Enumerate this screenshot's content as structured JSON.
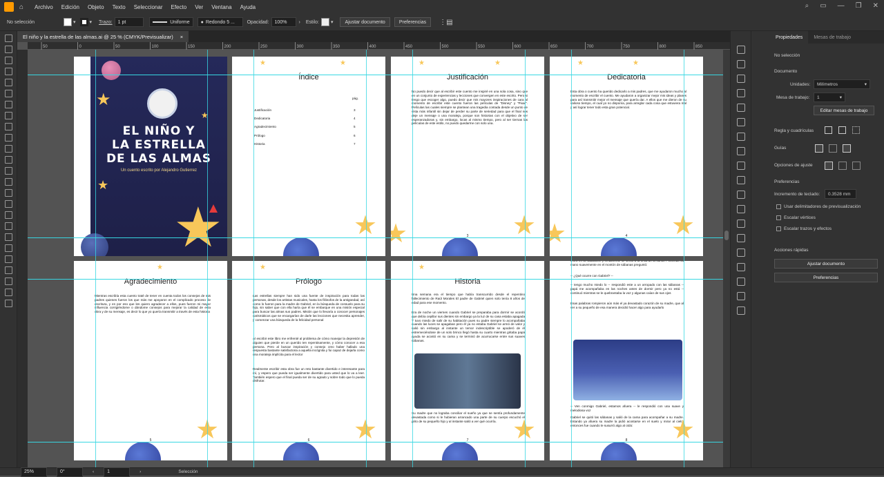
{
  "menubar": {
    "items": [
      "Archivo",
      "Edición",
      "Objeto",
      "Texto",
      "Seleccionar",
      "Efecto",
      "Ver",
      "Ventana",
      "Ayuda"
    ]
  },
  "control": {
    "selection": "No selección",
    "stroke_label": "Trazo:",
    "stroke_value": "1 pt",
    "profile": "Uniforme",
    "brush": "Redondo 5 ...",
    "opacity_label": "Opacidad:",
    "opacity_value": "100%",
    "style_label": "Estilo:",
    "fit_button": "Ajustar documento",
    "prefs_button": "Preferencias"
  },
  "doc_tab": {
    "title": "El niño y la estrella de las almas.ai @ 25 % (CMYK/Previsualizar)",
    "close": "×"
  },
  "ruler": {
    "ticks": [
      "50",
      "0",
      "50",
      "100",
      "150",
      "200",
      "250",
      "300",
      "350",
      "400",
      "450",
      "500",
      "550",
      "600",
      "650",
      "700",
      "750",
      "800",
      "850",
      "900"
    ]
  },
  "pages": {
    "cover": {
      "title_line1": "EL NIÑO Y",
      "title_line2": "LA ESTRELLA",
      "title_line3": "DE LAS ALMAS",
      "subtitle": "Un cuento escrito por Alejandro Gutierrez"
    },
    "indice": {
      "title": "Índice",
      "pag_label": "pág.",
      "entries": [
        {
          "label": "Justificación",
          "page": "3"
        },
        {
          "label": "Dedicatoria",
          "page": "4"
        },
        {
          "label": "Agradecimiento",
          "page": "5"
        },
        {
          "label": "Prólogo",
          "page": "6"
        },
        {
          "label": "Historia",
          "page": "7"
        }
      ]
    },
    "justificacion": {
      "title": "Justificación",
      "text": "No puedo decir que al escribir este cuento me inspiré en una sola cosa, sino que en un conjunto de experiencias y lecciones que convergen en este escrito. Pero si tengo que escoger algo, puedo decir que mis mayores inspiraciones de cara al momento de escribir este cuento fueron las películas de \"Disney\" y \"Pixar\". Películas las cuales siempre se plantean una tragedia contada desde un punto de vista más infantil sin dejar de perder su parte de seriedad para que el final nos deje un mensaje o una moraleja, porque son historias con el objetivo de ser esperanzadoras y, sin embargo, locas al mismo tiempo, pero al ser tiernas las películas de este estilo, no puedo quedarme con solo una.",
      "number": "3"
    },
    "dedicatoria": {
      "title": "Dedicatoria",
      "text": "Esta obra o cuento ha querido dedicarlo a mis padres, que me ayudaron mucho al momento de escribir el cuento. Me ayudaron a organizar mejor mis ideas y planes para así transmitir mejor el mensaje que quería dar. A ellos que me dieron de su valioso tiempo, el cual yo no disponía, para arreglar cada cosa que estuviera mal y así lograr tener todo esta gran potencial.",
      "number": "4"
    },
    "agradecimiento": {
      "title": "Agradecimiento",
      "text": "Mientras escribía esta cuento traté de tener en cuenta todos los consejos de mis padres quienes fueron los que más me apoyaron en el complicado proceso de escritura, y en por eso que les quiero agradecer a ellos, pues fueron mi mayor influencia corrigiéndome o dándome consejos para mejorar la calidad de esta obra y de su mensaje, es decir lo que yo quería transmitir a través de esta historia",
      "number": "5"
    },
    "prologo": {
      "title": "Prólogo",
      "p1": "Las estrellas siempre han sido una fuente de inspiración para todas las personas, desde los artistas musicales, hasta los filósofos de la antigüedad, así como lo fueron para la madre de Gabriel, en la búsqueda de consuelo para su hijo, sin saber que con ella haría que él se embarque en una misión especial para buscar las almas sus padres. Misión que lo llevaría a conocer personajes carismáticos que se encargarían de darle las lecciones que necesita aprender, y comenzar una búsqueda de la felicidad personal",
      "p2": "Al escribir este libro me enfrenté al problema de cómo manejar la depresión de alguien que pierde en un querido ten repentinamente, y cómo conocer a esa persona. Pero al buscar inspiración y consejo creo haber hallado una respuesta bastante satisfactoria a aquella incógnita y fui capaz de dejarla como una moraleja implícita para el lector",
      "p3": "Realmente escribir esta obra fue un reto bastante divertido e interesante para mí, y espero que pueda ser igualmente divertido para usted que lo va a leer. También espero que el final pueda ser de su agrado y sobre todo que lo pueda disfrutar.",
      "number": "6"
    },
    "historia": {
      "title": "Historia",
      "p1": "Una semana era el tiempo que había transcurrido desde el repentino fallecimiento de Raúl Morales El padre de Gabriel quien solo tenía 8 años de edad para ese momento.",
      "p2": "Era de noche un viernes cuando Gabriel se preparaba para dormir se acordó que debía cepillar sus dientes sin embargo ya la luz de su casa estaba apagada Y tuvo miedo de salir de su habitación pues su padre siempre lo acompañaba cuando las luces se apagaban pero él ya no estaba Gabriel se armó de valor y salió sin embargo al instante un temor indescriptible se apoderó de él estremeciéndose de un solo brinco llegó hasta su cuarto mientras gritaba papá ayuda se acostó en su cama y se terminó de acurrucarse entre sus suaves sábanas.",
      "p3": "Su madre que no lograba conciliar el sueño ya que se sentía profundamente devastada como si le hubieran arrancado una parte de su cuerpo escuchó el grito de su pequeño hijo y al instante salió a ver qué ocurría.",
      "number": "7"
    },
    "page8": {
      "p1": "entró en la habitación y lentamente se sentó a la orilla de la cama. Poniendo su mano suavemente en el montón de sábanas preguntó:",
      "p2": "-- ¿Qué ocurre con Gabriel? --",
      "p3": "-- tengo mucho miedo lo -- respondió este a un arropado con las sábanas -- papá me acompañaba en las noches antes de dormir pero ya no está -- continuó mientras se le quebrantaba la voz y algunas caían de sus ojos",
      "p4": "Esas palabras rompieron aún más el ya devastado corazón de su madre, que al ver a su pequeño de esa manera decidió hacer algo para ayudarlo",
      "p5": "-- Ven conmigo Gabriel, estamos afuera -- le respondió con una suave y melodiosa voz",
      "p6": "Gabriel se quitó las sábanas y salió de la cama para acompañar a su madre. Estando ya afuera su madre la pidió acostarse en el suelo y mirar al cielo, entonces fue cuando le susurró algo al oído:",
      "number": "8"
    }
  },
  "right_tabs": {
    "propiedades": "Propiedades",
    "mesas": "Mesas de trabajo"
  },
  "properties": {
    "no_selection": "No selección",
    "documento": "Documento",
    "unidades_label": "Unidades:",
    "unidades_value": "Milímetros",
    "mesa_label": "Mesa de trabajo:",
    "mesa_value": "1",
    "edit_artboards": "Editar mesas de trabajo",
    "regla": "Regla y cuadrículas",
    "guias": "Guías",
    "ajuste": "Opciones de ajuste",
    "preferencias": "Preferencias",
    "incremento_label": "Incremento de teclado:",
    "incremento_value": "0.3528 mm",
    "chk1": "Usar delimitadores de previsualización",
    "chk2": "Escalar vértices",
    "chk3": "Escalar trazos y efectos",
    "acciones": "Acciones rápidas",
    "btn_fit": "Ajustar documento",
    "btn_prefs": "Preferencias"
  },
  "statusbar": {
    "zoom": "25%",
    "rotation": "0°",
    "artboard": "1",
    "mode": "Selección"
  }
}
